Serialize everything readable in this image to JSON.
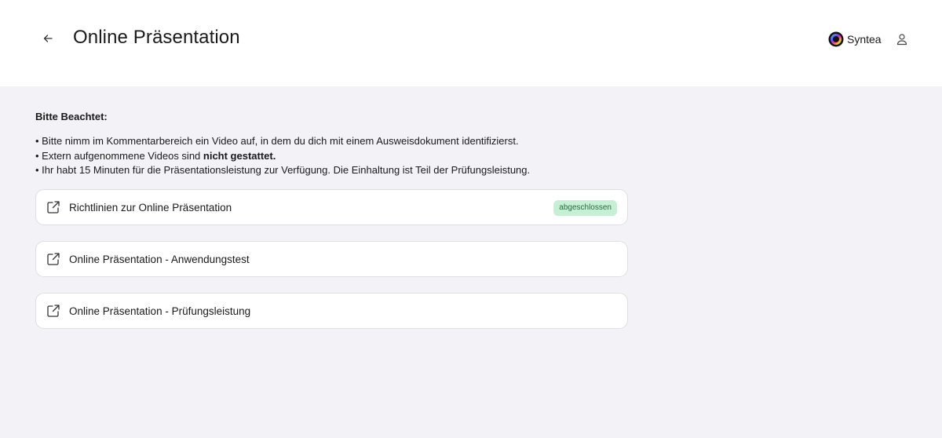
{
  "header": {
    "title": "Online Präsentation",
    "back_icon": "arrow-left-icon",
    "brand_name": "Syntea",
    "brand_icon": "syntea-logo",
    "user_icon": "user-icon"
  },
  "notice": {
    "heading": "Bitte Beachtet:",
    "items": [
      {
        "text": "• Bitte nimm im Kommentarbereich ein Video auf, in dem du dich mit einem Ausweisdokument identifizierst."
      },
      {
        "prefix": "• Extern aufgenommene Videos sind ",
        "bold": "nicht gestattet."
      },
      {
        "text": "• Ihr habt 15 Minuten für die Präsentationsleistung zur Verfügung. Die Einhaltung ist Teil der Prüfungsleistung."
      }
    ]
  },
  "cards": [
    {
      "label": "Richtlinien zur Online Präsentation",
      "icon": "external-link-icon",
      "badge": "abgeschlossen"
    },
    {
      "label": "Online Präsentation - Anwendungstest",
      "icon": "external-link-icon"
    },
    {
      "label": "Online Präsentation - Prüfungsleistung",
      "icon": "external-link-icon"
    }
  ],
  "colors": {
    "page_bg": "#f3f3f7",
    "header_bg": "#ffffff",
    "badge_bg": "#c6f0d5",
    "badge_text": "#2b6a3e"
  }
}
